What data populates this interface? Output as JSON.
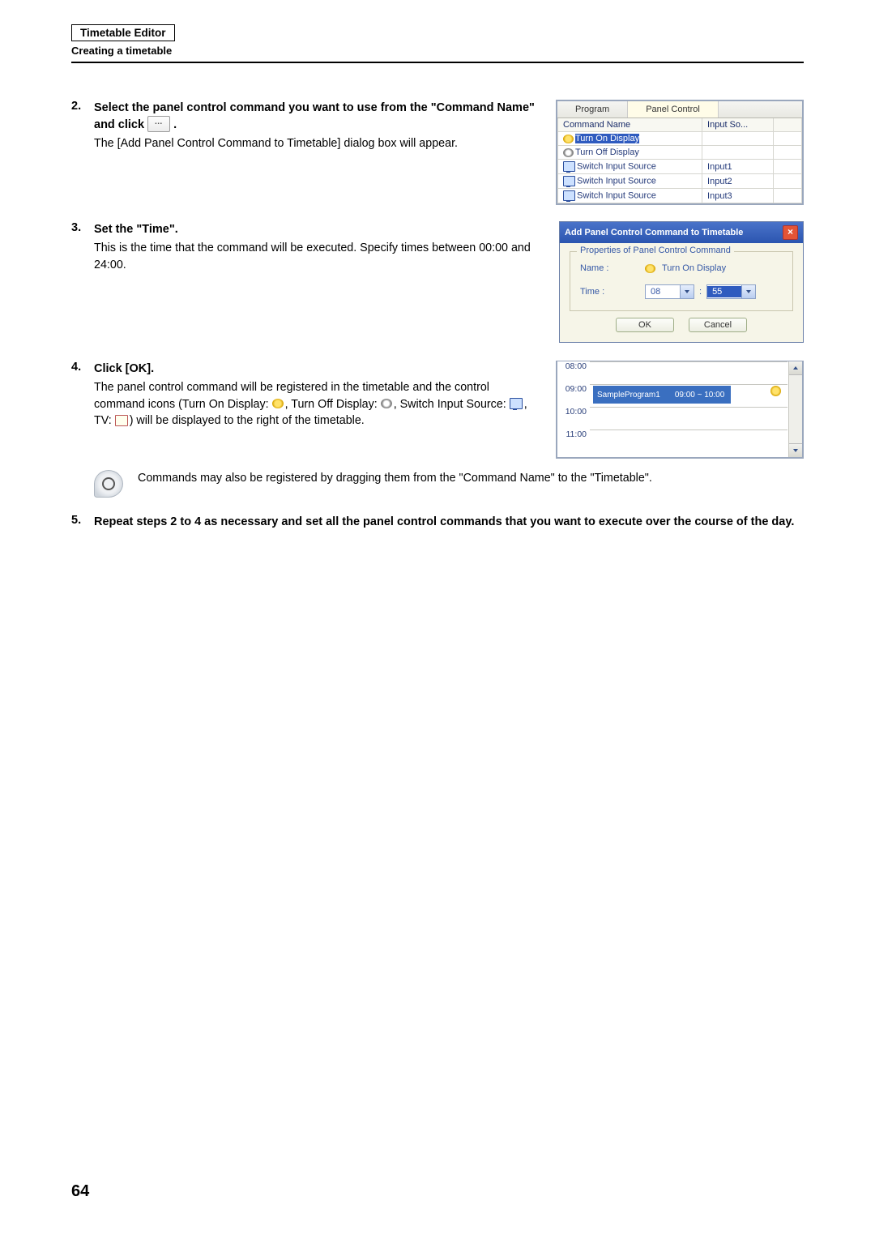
{
  "header": {
    "box": "Timetable Editor",
    "sub": "Creating a timetable"
  },
  "steps": {
    "s2": {
      "num": "2.",
      "title_a": "Select the panel control command you want to use from the \"Command Name\" and click ",
      "title_b": " .",
      "desc": "The [Add Panel Control Command to Timetable] dialog box will appear."
    },
    "s3": {
      "num": "3.",
      "title": "Set the \"Time\".",
      "desc": "This is the time that the command will be executed. Specify times between 00:00 and 24:00."
    },
    "s4": {
      "num": "4.",
      "title": "Click [OK].",
      "desc_a": "The panel control command will be registered in the timetable and the control command icons (Turn On Display: ",
      "desc_b": ", Turn Off Display: ",
      "desc_c": ", Switch Input Source: ",
      "desc_d": ", TV: ",
      "desc_e": ") will be displayed to the right of the timetable."
    },
    "note": "Commands may also be registered by dragging them from the \"Command Name\" to the \"Timetable\".",
    "s5": {
      "num": "5.",
      "title": "Repeat steps 2 to 4 as necessary and set all the panel control commands that you want to execute over the course of the day."
    }
  },
  "fig1": {
    "tabs": {
      "program": "Program",
      "panel": "Panel Control"
    },
    "headers": {
      "name": "Command Name",
      "src": "Input So..."
    },
    "rows": [
      {
        "icon": "bulb-on",
        "name": "Turn On Display",
        "src": "",
        "sel": true
      },
      {
        "icon": "bulb-off",
        "name": "Turn Off Display",
        "src": "",
        "sel": false
      },
      {
        "icon": "monitor",
        "name": "Switch Input Source",
        "src": "Input1",
        "sel": false
      },
      {
        "icon": "monitor",
        "name": "Switch Input Source",
        "src": "Input2",
        "sel": false
      },
      {
        "icon": "monitor",
        "name": "Switch Input Source",
        "src": "Input3",
        "sel": false
      }
    ]
  },
  "dialog": {
    "title": "Add Panel Control Command to Timetable",
    "group": "Properties of Panel Control Command",
    "name_label": "Name :",
    "name_value": "Turn On Display",
    "time_label": "Time :",
    "time_hour": "08",
    "time_colon": ":",
    "time_min": "55",
    "ok": "OK",
    "cancel": "Cancel"
  },
  "timetable": {
    "times": [
      "08:00",
      "09:00",
      "10:00",
      "11:00"
    ],
    "block_name": "SampleProgram1",
    "block_range": "09:00 ~ 10:00"
  },
  "page_num": "64"
}
